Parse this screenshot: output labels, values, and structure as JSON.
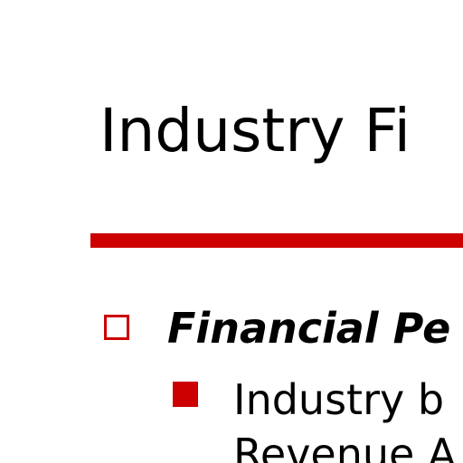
{
  "colors": {
    "accent": "#cc0000",
    "text": "#000000",
    "background": "#ffffff"
  },
  "slide": {
    "title": "Industry Fi",
    "bullets": [
      {
        "level": 1,
        "marker": "hollow-square",
        "text": "Financial Pe"
      },
      {
        "level": 2,
        "marker": "filled-square",
        "lines": [
          "Industry b",
          "Revenue A"
        ]
      }
    ]
  }
}
